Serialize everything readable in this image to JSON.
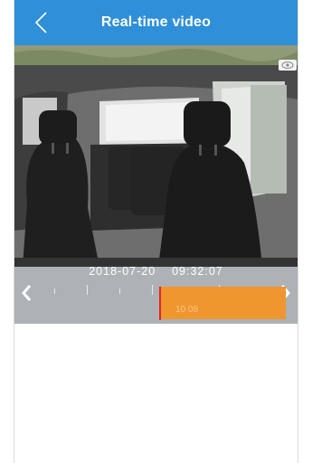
{
  "header": {
    "title": "Real-time video",
    "back_icon": "chevron-left-icon"
  },
  "video": {
    "description_icon": "camera-feed",
    "overlay_icon": "eye-icon"
  },
  "timeline": {
    "date": "2018-07-20",
    "time": "09:32:07",
    "segment_label": "10 08",
    "prev_icon": "chevron-left-icon",
    "next_icon": "chevron-right-icon",
    "colors": {
      "track": "#aeb1b5",
      "segment": "#f0962e",
      "marker": "#e0272b"
    }
  },
  "colors": {
    "header": "#2f8fd8"
  }
}
